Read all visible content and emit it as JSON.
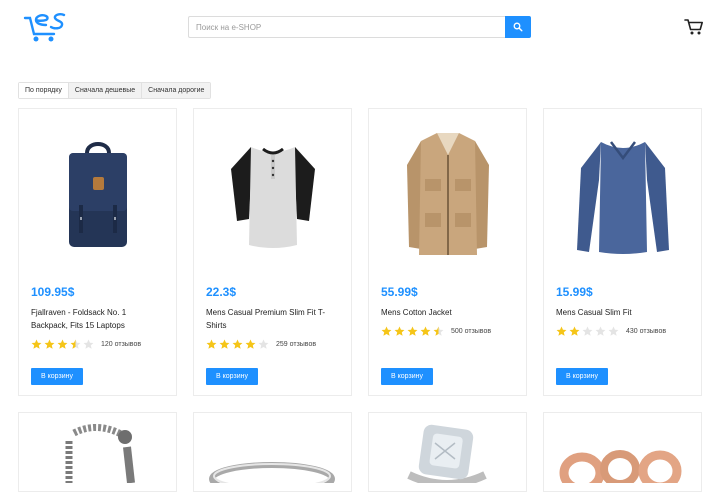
{
  "header": {
    "search_placeholder": "Поиск на e-SHOP",
    "accent_color": "#1e90ff",
    "logo_icon": "es-cart-logo",
    "search_icon": "magnifier",
    "cart_icon": "shopping-cart"
  },
  "sort": {
    "options": [
      "По порядку",
      "Сначала дешевые",
      "Сначала дорогие"
    ],
    "selected": "По порядку"
  },
  "products": [
    {
      "price": "109.95$",
      "name": "Fjallraven - Foldsack No. 1 Backpack, Fits 15 Laptops",
      "rating": 3.5,
      "reviews": "120 отзывов",
      "buy_label": "В корзину",
      "image": "navy-backpack"
    },
    {
      "price": "22.3$",
      "name": "Mens Casual Premium Slim Fit T-Shirts",
      "rating": 4,
      "reviews": "259 отзывов",
      "buy_label": "В корзину",
      "image": "raglan-henley-shirt"
    },
    {
      "price": "55.99$",
      "name": "Mens Cotton Jacket",
      "rating": 4.5,
      "reviews": "500 отзывов",
      "buy_label": "В корзину",
      "image": "beige-cotton-jacket"
    },
    {
      "price": "15.99$",
      "name": "Mens Casual Slim Fit",
      "rating": 2,
      "reviews": "430 отзывов",
      "buy_label": "В корзину",
      "image": "blue-long-sleeve-shirt"
    }
  ],
  "second_row": [
    {
      "image": "dragon-chain-bracelet"
    },
    {
      "image": "silver-band-ring"
    },
    {
      "image": "diamond-halo-ring"
    },
    {
      "image": "rose-gold-rings"
    }
  ]
}
